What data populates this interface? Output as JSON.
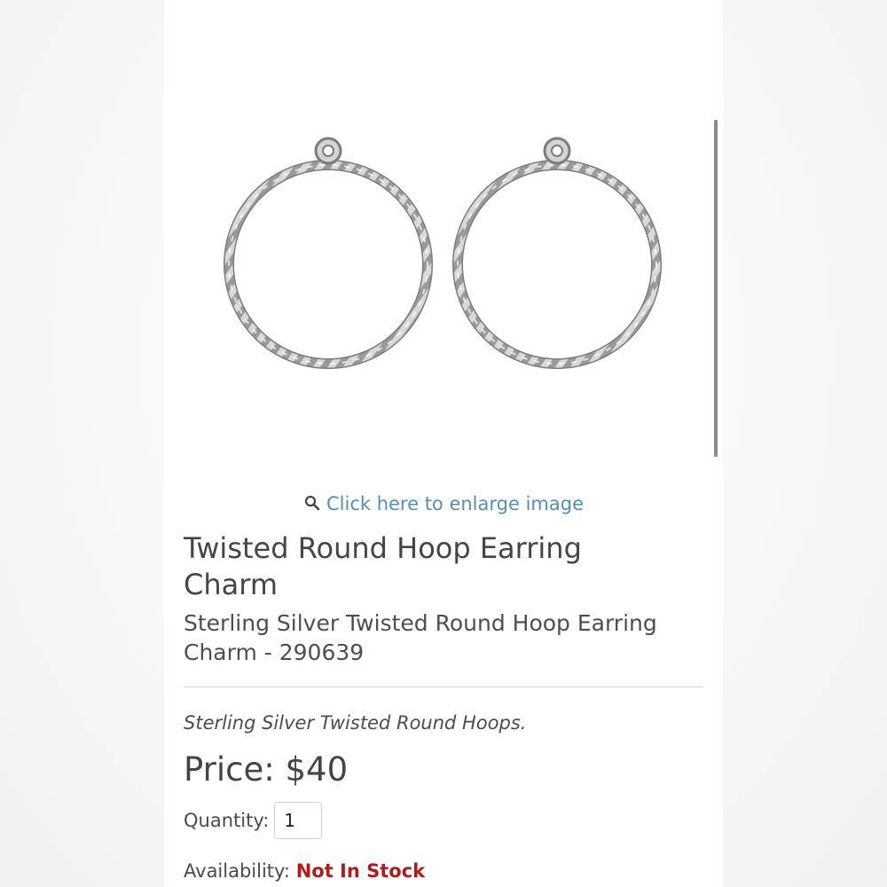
{
  "enlarge_link": {
    "icon": "search-icon",
    "label": "Click here to enlarge image"
  },
  "product": {
    "title": "Twisted Round Hoop Earring Charm",
    "subtitle": "Sterling Silver Twisted Round Hoop Earring Charm - 290639",
    "description": "Sterling Silver Twisted Round Hoops.",
    "price": "Price: $40",
    "quantity_label": "Quantity:",
    "quantity_value": "1",
    "availability_label": "Availability:",
    "availability_status": "Not In Stock"
  },
  "colors": {
    "link": "#5a8db2",
    "status_out_of_stock": "#b01c1c",
    "text": "#454545"
  }
}
